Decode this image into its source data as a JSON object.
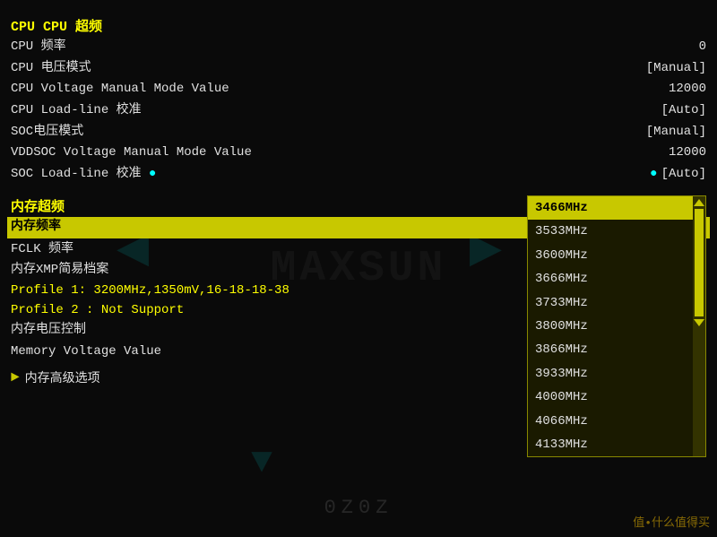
{
  "bios": {
    "bg_logo": "MAXSUN",
    "sections": {
      "cpu_overclock": {
        "header": "CPU 超频",
        "rows": [
          {
            "label": "CPU 频率",
            "value": "0"
          },
          {
            "label": "CPU 电压模式",
            "value": "[Manual]"
          },
          {
            "label": "CPU Voltage Manual Mode Value",
            "value": "12000"
          },
          {
            "label": "CPU Load-line 校准",
            "value": "[Auto]"
          },
          {
            "label": "SOC电压模式",
            "value": "[Manual]"
          },
          {
            "label": "VDDSOC Voltage Manual Mode Value",
            "value": "12000"
          },
          {
            "label": "SOC Load-line 校准",
            "value": "[Auto]",
            "has_dot": true
          }
        ]
      },
      "mem_overclock": {
        "header": "内存超频",
        "rows": [
          {
            "label": "内存频率",
            "value": "[3466MHz]",
            "highlighted": true
          },
          {
            "label": "FCLK 频率",
            "value": ""
          },
          {
            "label": "内存XMP简易档案",
            "value": ""
          }
        ]
      },
      "profile_info": {
        "profile1": "Profile 1: 3200MHz,1350mV,16-18-18-38",
        "profile2": "Profile 2 : Not Support"
      },
      "mem_rows": [
        {
          "label": "内存电压控制",
          "value": ""
        },
        {
          "label": "Memory Voltage Value",
          "value": ""
        }
      ],
      "advanced": {
        "label": "内存高级选项"
      }
    },
    "dropdown": {
      "items": [
        {
          "value": "3466MHz",
          "selected": true
        },
        {
          "value": "3533MHz",
          "selected": false
        },
        {
          "value": "3600MHz",
          "selected": false
        },
        {
          "value": "3666MHz",
          "selected": false
        },
        {
          "value": "3733MHz",
          "selected": false
        },
        {
          "value": "3800MHz",
          "selected": false
        },
        {
          "value": "3866MHz",
          "selected": false
        },
        {
          "value": "3933MHz",
          "selected": false
        },
        {
          "value": "4000MHz",
          "selected": false
        },
        {
          "value": "4066MHz",
          "selected": false
        },
        {
          "value": "4133MHz",
          "selected": false
        }
      ]
    },
    "watermark": "值•什么值得买"
  }
}
